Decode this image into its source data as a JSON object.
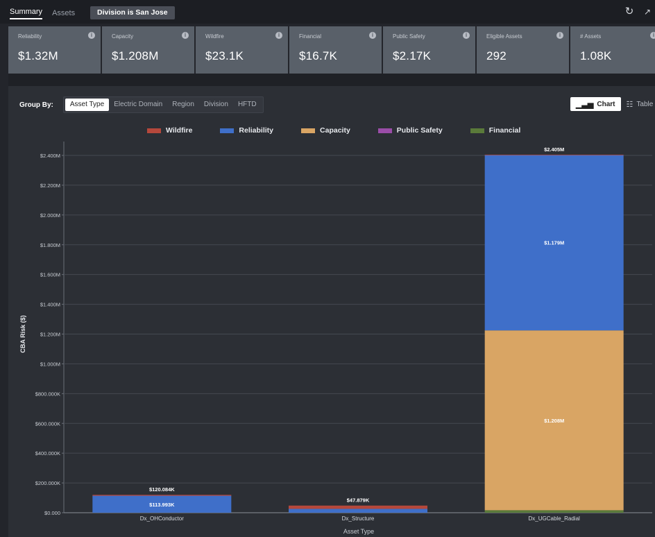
{
  "tabs": [
    {
      "label": "Summary",
      "active": true
    },
    {
      "label": "Assets",
      "active": false
    }
  ],
  "filter_chip": "Division is San Jose",
  "kpis": [
    {
      "label": "Reliability",
      "value": "$1.32M"
    },
    {
      "label": "Capacity",
      "value": "$1.208M"
    },
    {
      "label": "Wildfire",
      "value": "$23.1K"
    },
    {
      "label": "Financial",
      "value": "$16.7K"
    },
    {
      "label": "Public Safety",
      "value": "$2.17K"
    },
    {
      "label": "Eligible Assets",
      "value": "292"
    },
    {
      "label": "# Assets",
      "value": "1.08K"
    }
  ],
  "group_by": {
    "label": "Group By:",
    "options": [
      "Asset Type",
      "Electric Domain",
      "Region",
      "Division",
      "HFTD"
    ],
    "selected": "Asset Type"
  },
  "view_toggle": {
    "chart": "Chart",
    "table": "Table",
    "selected": "Chart"
  },
  "colors": {
    "Wildfire": "#b5483c",
    "Reliability": "#3f6fc9",
    "Capacity": "#d9a564",
    "Public Safety": "#9a4da8",
    "Financial": "#5a7a3a"
  },
  "chart_data": {
    "type": "bar",
    "stacked": true,
    "xlabel": "Asset Type",
    "ylabel": "CBA Risk ($)",
    "ylim": [
      0,
      2400000
    ],
    "yticks": [
      0,
      200000,
      400000,
      600000,
      800000,
      1000000,
      1200000,
      1400000,
      1600000,
      1800000,
      2000000,
      2200000,
      2400000
    ],
    "ytick_labels": [
      "$0.000",
      "$200.000K",
      "$400.000K",
      "$600.000K",
      "$800.000K",
      "$1.000M",
      "$1.200M",
      "$1.400M",
      "$1.600M",
      "$1.800M",
      "$2.000M",
      "$2.200M",
      "$2.400M"
    ],
    "categories": [
      "Dx_OHConductor",
      "Dx_Structure",
      "Dx_UGCable_Radial"
    ],
    "series": [
      {
        "name": "Financial",
        "values": [
          0,
          0,
          16700
        ]
      },
      {
        "name": "Capacity",
        "values": [
          0,
          0,
          1208000
        ]
      },
      {
        "name": "Reliability",
        "values": [
          113993,
          26000,
          1179000
        ]
      },
      {
        "name": "Public Safety",
        "values": [
          0,
          0,
          0
        ]
      },
      {
        "name": "Wildfire",
        "values": [
          6091,
          21879,
          1300
        ]
      }
    ],
    "totals": [
      120084,
      47879,
      2405000
    ],
    "total_labels": [
      "$120.084K",
      "$47.879K",
      "$2.405M"
    ],
    "segment_labels": [
      {
        "category": "Dx_OHConductor",
        "series": "Reliability",
        "text": "$113.993K"
      },
      {
        "category": "Dx_UGCable_Radial",
        "series": "Reliability",
        "text": "$1.179M"
      },
      {
        "category": "Dx_UGCable_Radial",
        "series": "Capacity",
        "text": "$1.208M"
      }
    ],
    "legend": [
      "Wildfire",
      "Reliability",
      "Capacity",
      "Public Safety",
      "Financial"
    ],
    "grid": true
  }
}
